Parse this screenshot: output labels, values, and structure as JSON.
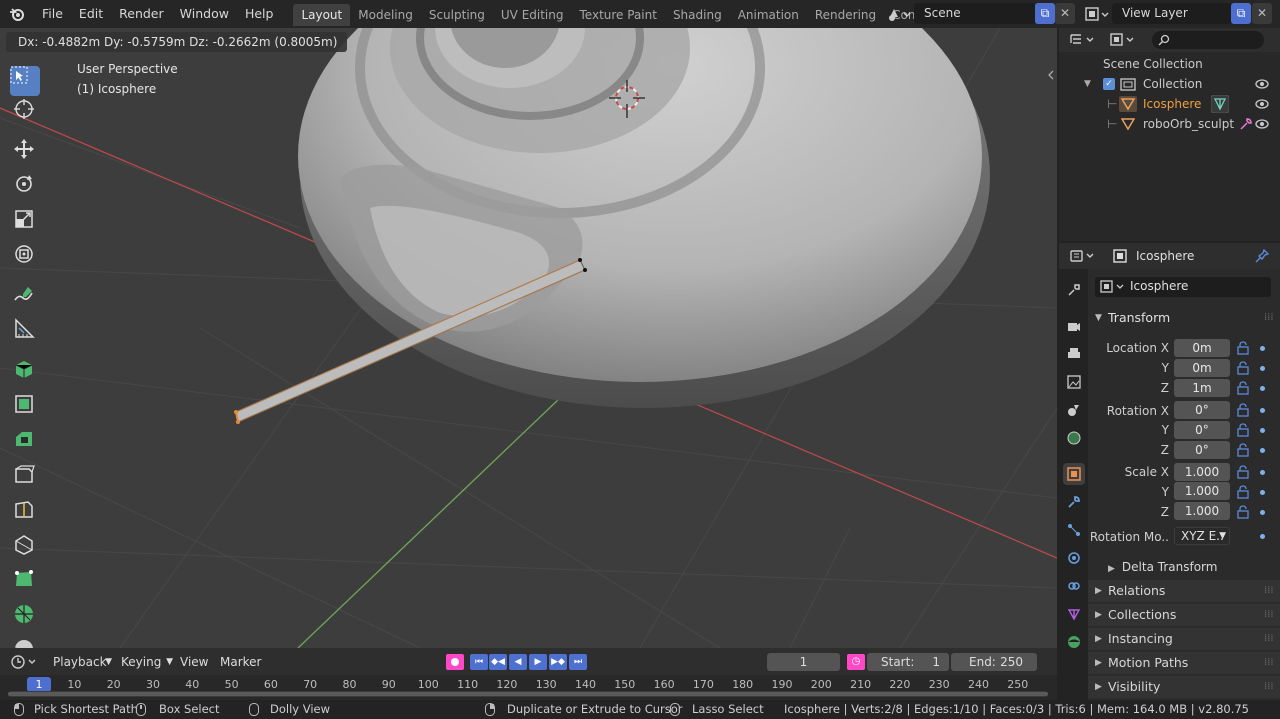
{
  "topbar": {
    "menus": [
      "File",
      "Edit",
      "Render",
      "Window",
      "Help"
    ],
    "workspaces": [
      "Layout",
      "Modeling",
      "Sculpting",
      "UV Editing",
      "Texture Paint",
      "Shading",
      "Animation",
      "Rendering",
      "Compositing"
    ],
    "active_workspace": "Layout",
    "scene": "Scene",
    "view_layer": "View Layer"
  },
  "viewport": {
    "hud": "Dx: -0.4882m   Dy: -0.5759m   Dz: -0.2662m (0.8005m)",
    "perspective": "User Perspective",
    "object_label": "(1) Icosphere",
    "colors": {
      "background": "#3d3d3d",
      "x_axis": "#b8494b",
      "y_axis": "#6fa757",
      "mesh_highlight": "#e08a38",
      "active_tool": "#5680c2"
    }
  },
  "toolbar": {
    "tools": [
      "select-box",
      "cursor",
      "move",
      "rotate",
      "scale",
      "transform",
      "annotate",
      "measure",
      "add-cube",
      "extrude-region",
      "inset-faces",
      "bevel",
      "loop-cut",
      "knife",
      "poly-build",
      "spin",
      "smooth"
    ]
  },
  "outliner": {
    "search_placeholder": "",
    "root": "Scene Collection",
    "collection": "Collection",
    "items": [
      {
        "name": "Icosphere",
        "active": true
      },
      {
        "name": "roboOrb_sculpt",
        "active": false
      }
    ]
  },
  "properties": {
    "header_object": "Icosphere",
    "object_name": "Icosphere",
    "transform_title": "Transform",
    "location_label": "Location X",
    "rotation_label": "Rotation X",
    "scale_label": "Scale X",
    "y_label": "Y",
    "z_label": "Z",
    "location": [
      "0m",
      "0m",
      "1m"
    ],
    "rotation": [
      "0°",
      "0°",
      "0°"
    ],
    "scale": [
      "1.000",
      "1.000",
      "1.000"
    ],
    "rotation_mode_label": "Rotation Mo..",
    "rotation_mode": "XYZ E..",
    "delta_transform": "Delta Transform",
    "panels": [
      "Relations",
      "Collections",
      "Instancing",
      "Motion Paths",
      "Visibility"
    ]
  },
  "timeline": {
    "menus": [
      "Playback",
      "Keying",
      "View",
      "Marker"
    ],
    "current_frame": "1",
    "start_label": "Start:",
    "start": "1",
    "end_label": "End:",
    "end": "250",
    "ruler": [
      "10",
      "20",
      "30",
      "40",
      "50",
      "60",
      "70",
      "80",
      "90",
      "100",
      "110",
      "120",
      "130",
      "140",
      "150",
      "160",
      "170",
      "180",
      "190",
      "200",
      "210",
      "220",
      "230",
      "240",
      "250"
    ],
    "playhead": "1"
  },
  "statusbar": {
    "pick_shortest_path": "Pick Shortest Path",
    "box_select": "Box Select",
    "dolly_view": "Dolly View",
    "duplicate_extrude": "Duplicate or Extrude to Cursor",
    "lasso_select": "Lasso Select",
    "stats": "Icosphere | Verts:2/8 | Edges:1/10 | Faces:0/3 | Tris:6 | Mem: 164.0 MB | v2.80.75"
  }
}
